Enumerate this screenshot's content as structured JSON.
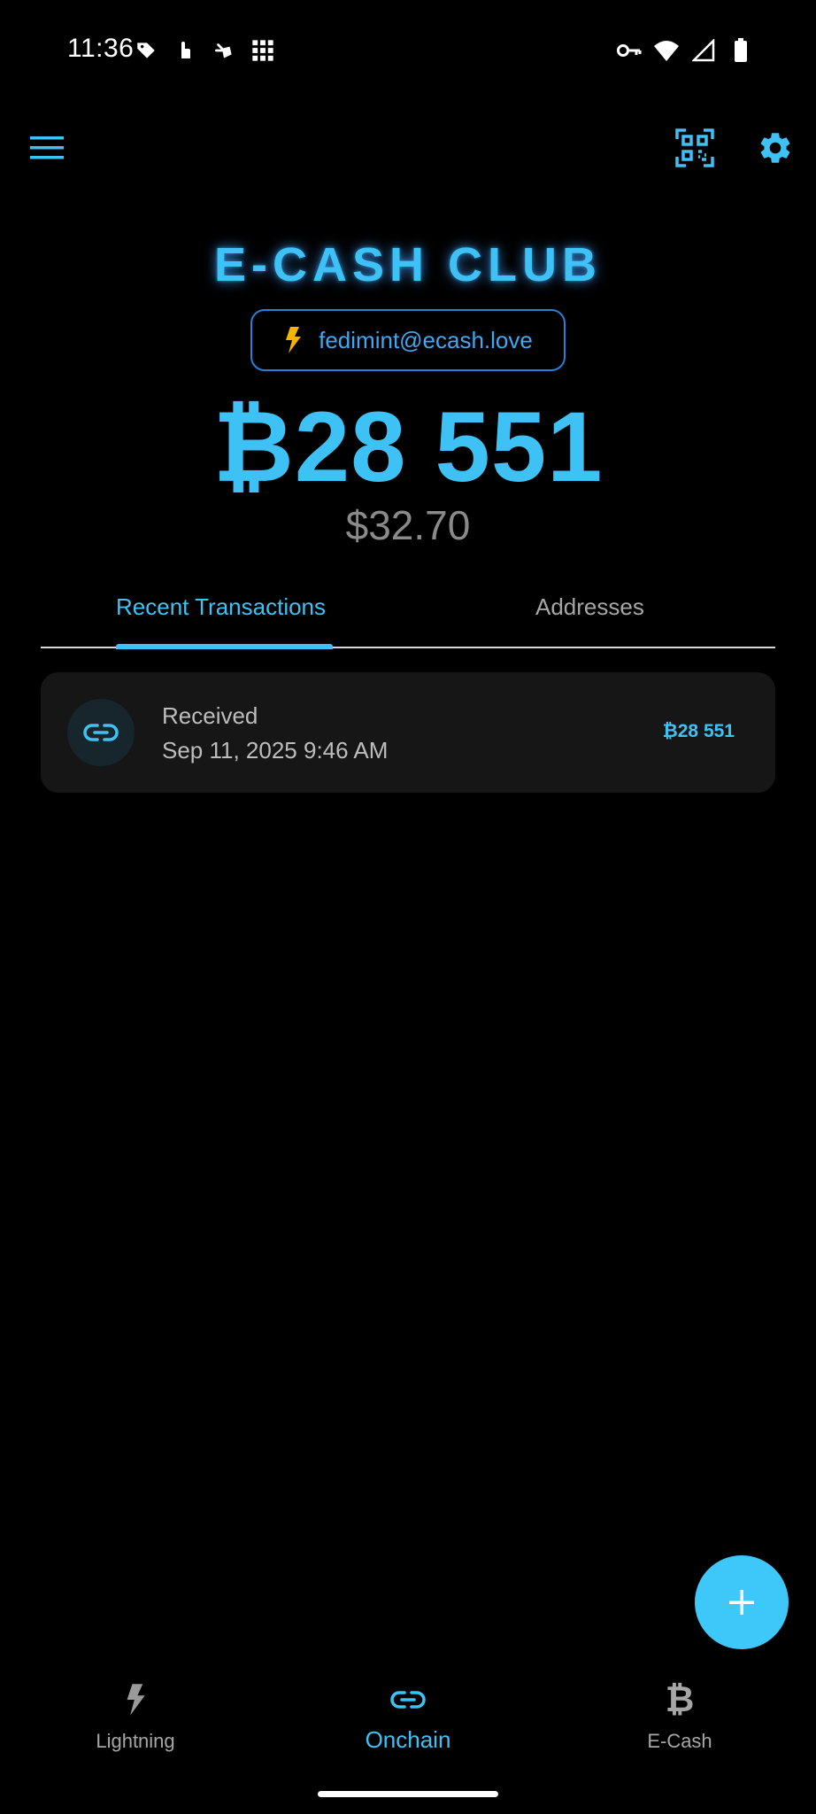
{
  "status_bar": {
    "time": "11:36"
  },
  "header": {
    "federation_name": "E-CASH CLUB",
    "lightning_address": "fedimint@ecash.love",
    "balance": "₿28 551",
    "fiat_balance": "$32.70"
  },
  "tabs": [
    {
      "label": "Recent Transactions",
      "active": true
    },
    {
      "label": "Addresses",
      "active": false
    }
  ],
  "transactions": [
    {
      "type": "Received",
      "date": "Sep 11, 2025 9:46 AM",
      "amount": "₿28 551",
      "icon": "link-icon"
    }
  ],
  "bottom_nav": {
    "items": [
      {
        "label": "Lightning",
        "icon": "lightning-icon",
        "active": false
      },
      {
        "label": "Onchain",
        "icon": "link-icon",
        "active": true
      },
      {
        "label": "E-Cash",
        "icon": "bitcoin-icon",
        "glyph": "₿",
        "active": false
      }
    ]
  },
  "colors": {
    "accent": "#3ec2f5",
    "background": "#000000",
    "card": "#161616",
    "muted_text": "#a6a6a6",
    "lightning_bolt": "#f5b400"
  }
}
